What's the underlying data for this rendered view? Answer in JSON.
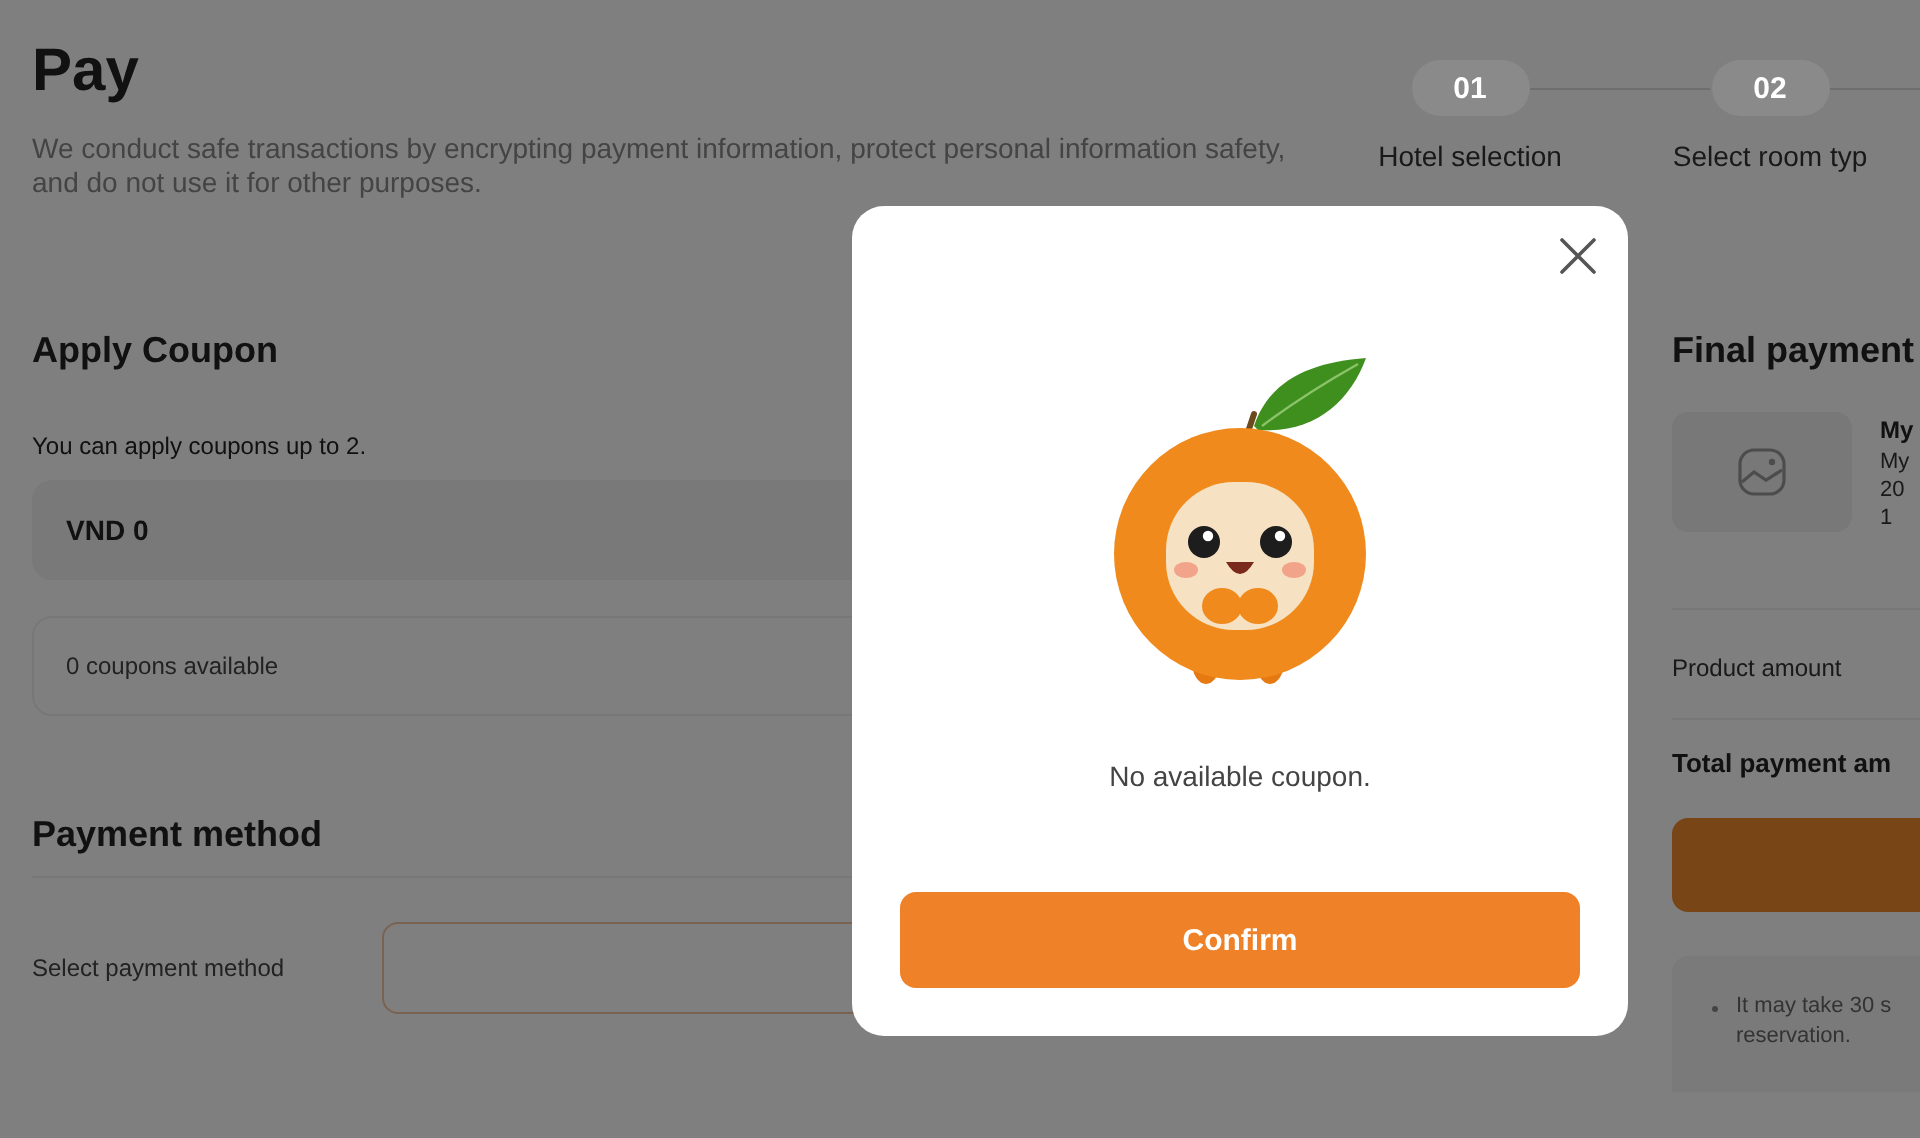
{
  "page": {
    "title": "Pay",
    "description": "We conduct safe transactions by encrypting payment information, protect personal information safety, and do not use it for other purposes."
  },
  "steps": [
    {
      "number": "01",
      "label": "Hotel selection"
    },
    {
      "number": "02",
      "label": "Select room typ"
    }
  ],
  "coupon": {
    "heading": "Apply Coupon",
    "hint": "You can apply coupons up to 2.",
    "amount": "VND 0",
    "available": "0 coupons available"
  },
  "payment_method": {
    "heading": "Payment method",
    "label": "Select payment method"
  },
  "summary": {
    "heading": "Final payment",
    "product": {
      "name": "My",
      "subtitle": "My",
      "date": "20",
      "detail": "1"
    },
    "product_amount_label": "Product amount",
    "total_label": "Total payment am",
    "notes": [
      {
        "lines": [
          "It may take 30 s",
          "reservation."
        ]
      }
    ]
  },
  "dialog": {
    "message": "No available coupon.",
    "confirm": "Confirm"
  }
}
